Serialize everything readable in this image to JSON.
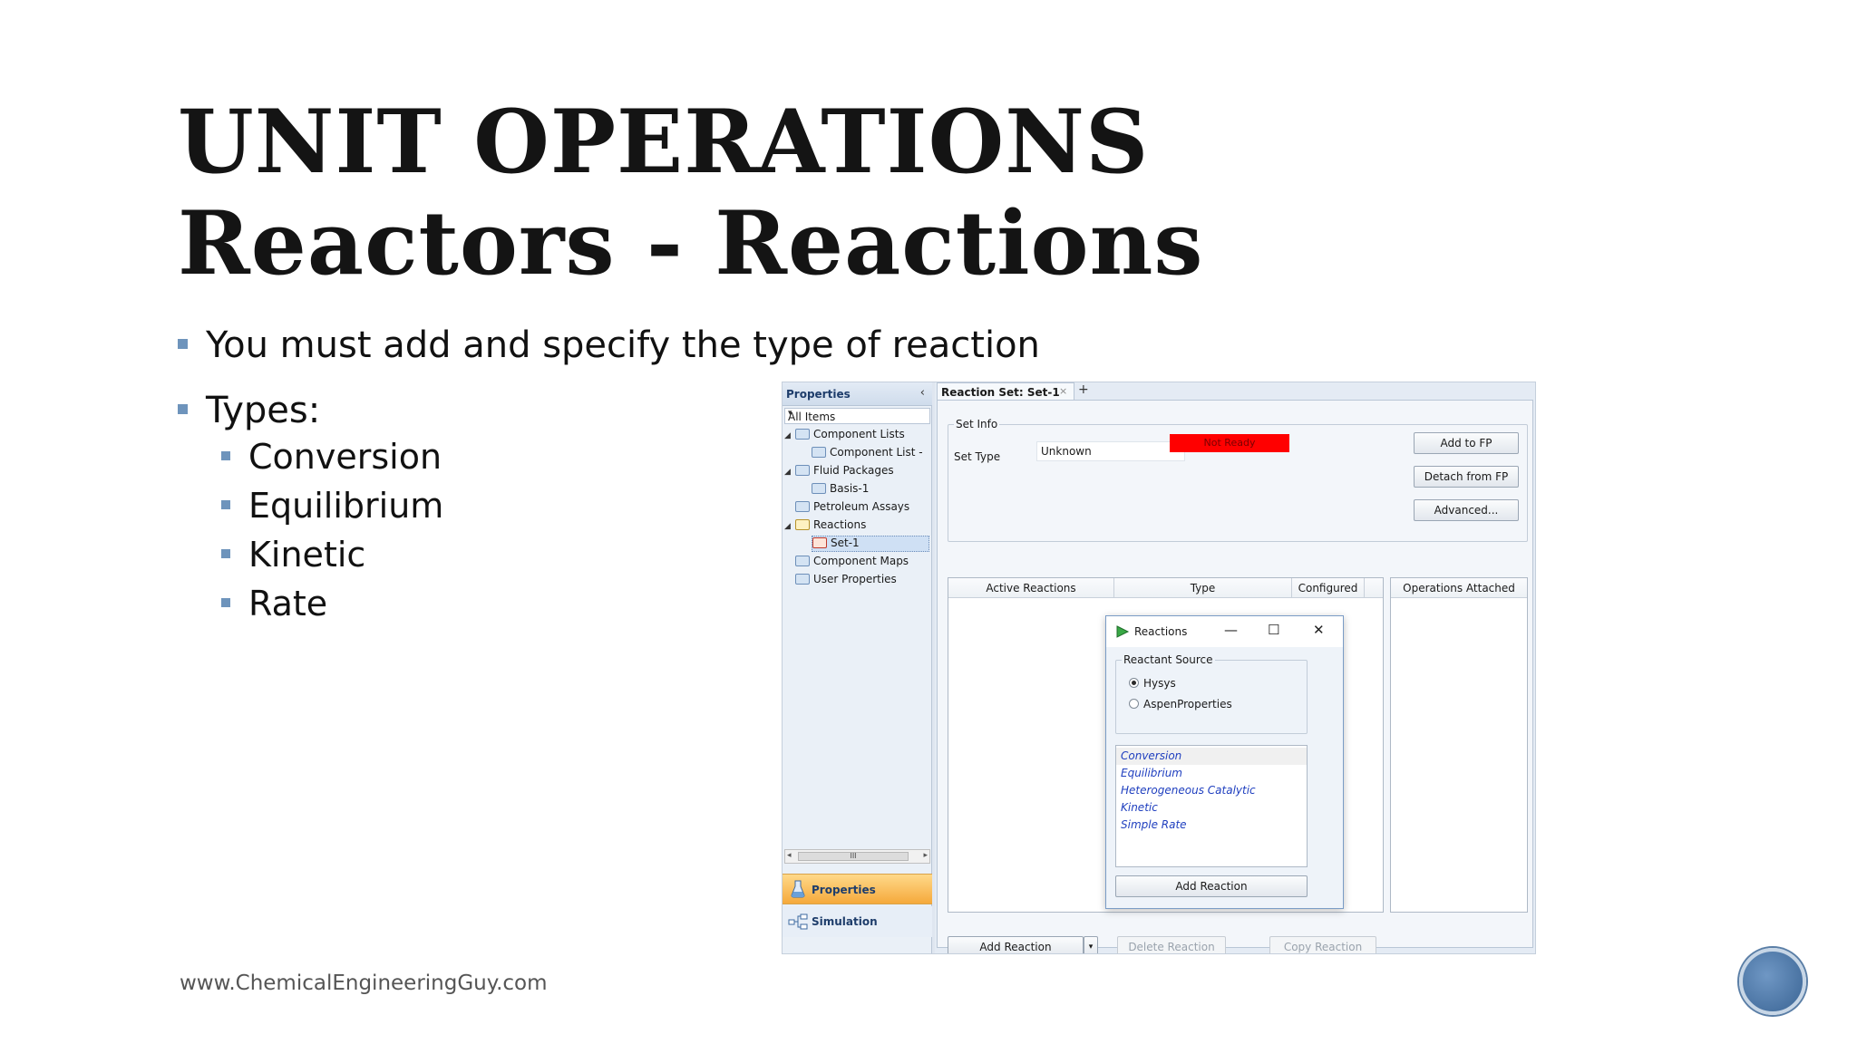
{
  "slide": {
    "title_line1": "UNIT OPERATIONS",
    "title_line2": "Reactors - Reactions",
    "bullets": [
      "You must add and specify the type of reaction",
      "Types:"
    ],
    "sub_bullets": [
      "Conversion",
      "Equilibrium",
      "Kinetic",
      "Rate"
    ],
    "footer": "www.ChemicalEngineeringGuy.com",
    "accent_color": "#6e94bc"
  },
  "app": {
    "sidebar": {
      "title": "Properties",
      "collapse_icon": "chevron-left-icon",
      "filter": "All Items",
      "tree": [
        {
          "label": "Component Lists",
          "expanded": true
        },
        {
          "label": "Component List -"
        },
        {
          "label": "Fluid Packages",
          "expanded": true
        },
        {
          "label": "Basis-1"
        },
        {
          "label": "Petroleum Assays"
        },
        {
          "label": "Reactions",
          "expanded": true
        },
        {
          "label": "Set-1",
          "selected": true
        },
        {
          "label": "Component Maps"
        },
        {
          "label": "User Properties"
        }
      ],
      "scroll_thumb": "III",
      "nav_properties": "Properties",
      "nav_simulation": "Simulation"
    },
    "tab": {
      "label": "Reaction Set: Set-1",
      "close": "×",
      "add": "+"
    },
    "set_info": {
      "legend": "Set Info",
      "set_type_label": "Set Type",
      "set_type_value": "Unknown",
      "status": "Not Ready",
      "status_color": "#ff0000"
    },
    "buttons": {
      "add_to_fp": "Add to FP",
      "detach_from_fp": "Detach from FP",
      "advanced": "Advanced...",
      "add_reaction": "Add Reaction",
      "delete_reaction": "Delete Reaction",
      "copy_reaction": "Copy Reaction"
    },
    "reactions_table": {
      "columns": [
        "Active Reactions",
        "Type",
        "Configured"
      ]
    },
    "ops_table": {
      "header": "Operations Attached"
    }
  },
  "dialog": {
    "title": "Reactions",
    "controls": {
      "minimize": "—",
      "maximize": "☐",
      "close": "✕"
    },
    "source_legend": "Reactant Source",
    "sources": [
      {
        "label": "Hysys",
        "selected": true
      },
      {
        "label": "AspenProperties",
        "selected": false
      }
    ],
    "reaction_types": [
      "Conversion",
      "Equilibrium",
      "Heterogeneous Catalytic",
      "Kinetic",
      "Simple Rate"
    ],
    "add_button": "Add Reaction"
  }
}
